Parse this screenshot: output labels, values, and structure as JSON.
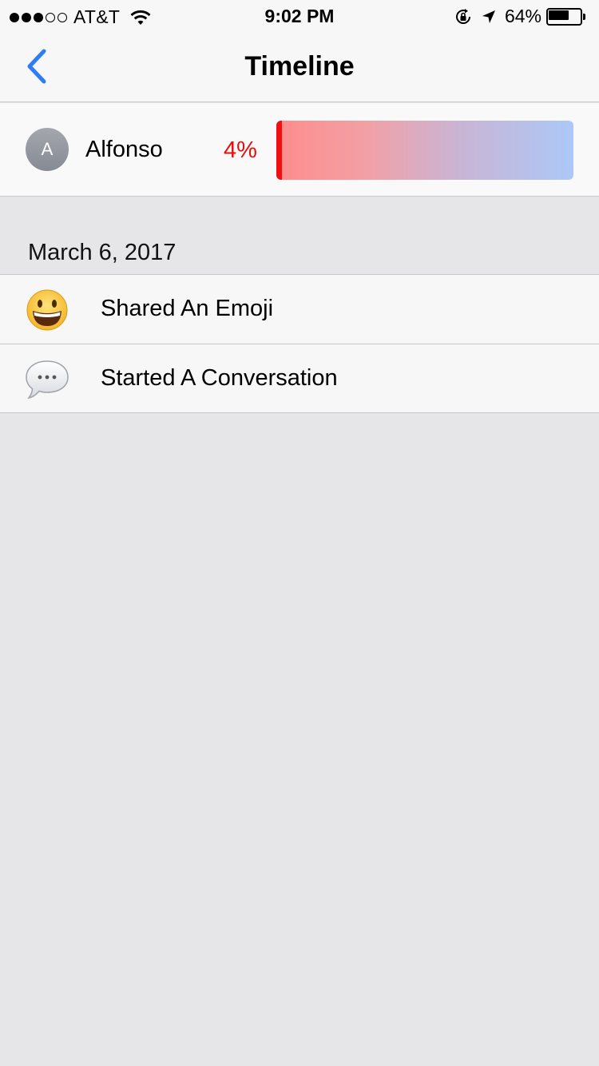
{
  "status_bar": {
    "signal_dots_filled": 3,
    "signal_dots_total": 5,
    "carrier": "AT&T",
    "time": "9:02 PM",
    "battery_percent": "64%",
    "battery_level": 0.64,
    "icons": [
      "wifi-icon",
      "orientation-lock-icon",
      "location-arrow-icon",
      "battery-icon"
    ]
  },
  "nav": {
    "title": "Timeline",
    "back_icon": "chevron-left-icon",
    "accent_color": "#2f7df6"
  },
  "contact": {
    "avatar_initial": "A",
    "name": "Alfonso",
    "percent_label": "4%",
    "progress_fraction": 0.04,
    "percent_color": "#e60d0d"
  },
  "timeline": {
    "date_header": "March 6, 2017",
    "items": [
      {
        "icon": "grinning-face-emoji-icon",
        "label": "Shared An Emoji"
      },
      {
        "icon": "speech-bubble-icon",
        "label": "Started A Conversation"
      }
    ]
  }
}
